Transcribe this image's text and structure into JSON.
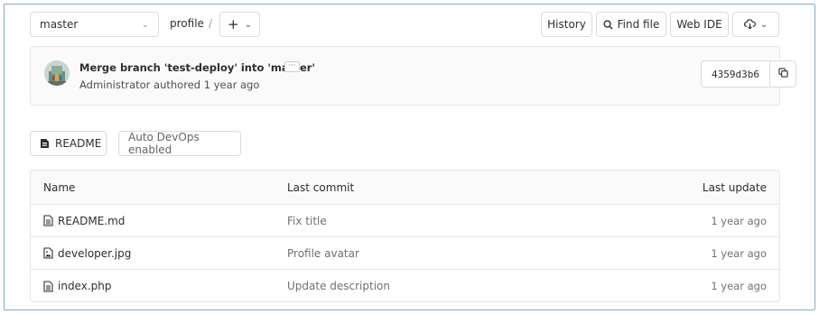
{
  "header": {
    "branch": "master",
    "path_segment": "profile",
    "path_separator": "/",
    "add_label": "+",
    "history_label": "History",
    "find_file_label": "Find file",
    "web_ide_label": "Web IDE"
  },
  "commit": {
    "title": "Merge branch 'test-deploy' into 'master'",
    "author_line": "Administrator authored 1 year ago",
    "more_label": "···",
    "sha": "4359d3b6"
  },
  "quick_actions": {
    "readme_label": "README",
    "devops_label": "Auto DevOps enabled"
  },
  "tree": {
    "headers": {
      "name": "Name",
      "last_commit": "Last commit",
      "last_update": "Last update"
    },
    "rows": [
      {
        "name": "README.md",
        "icon": "file-text-icon",
        "commit": "Fix title",
        "updated": "1 year ago"
      },
      {
        "name": "developer.jpg",
        "icon": "file-image-icon",
        "commit": "Profile avatar",
        "updated": "1 year ago"
      },
      {
        "name": "index.php",
        "icon": "file-text-icon",
        "commit": "Update description",
        "updated": "1 year ago"
      }
    ]
  },
  "colors": {
    "border": "#dbdbdb",
    "panel_bg": "#fafafa",
    "muted_text": "#707070",
    "frame_border": "#7fa9c6"
  }
}
